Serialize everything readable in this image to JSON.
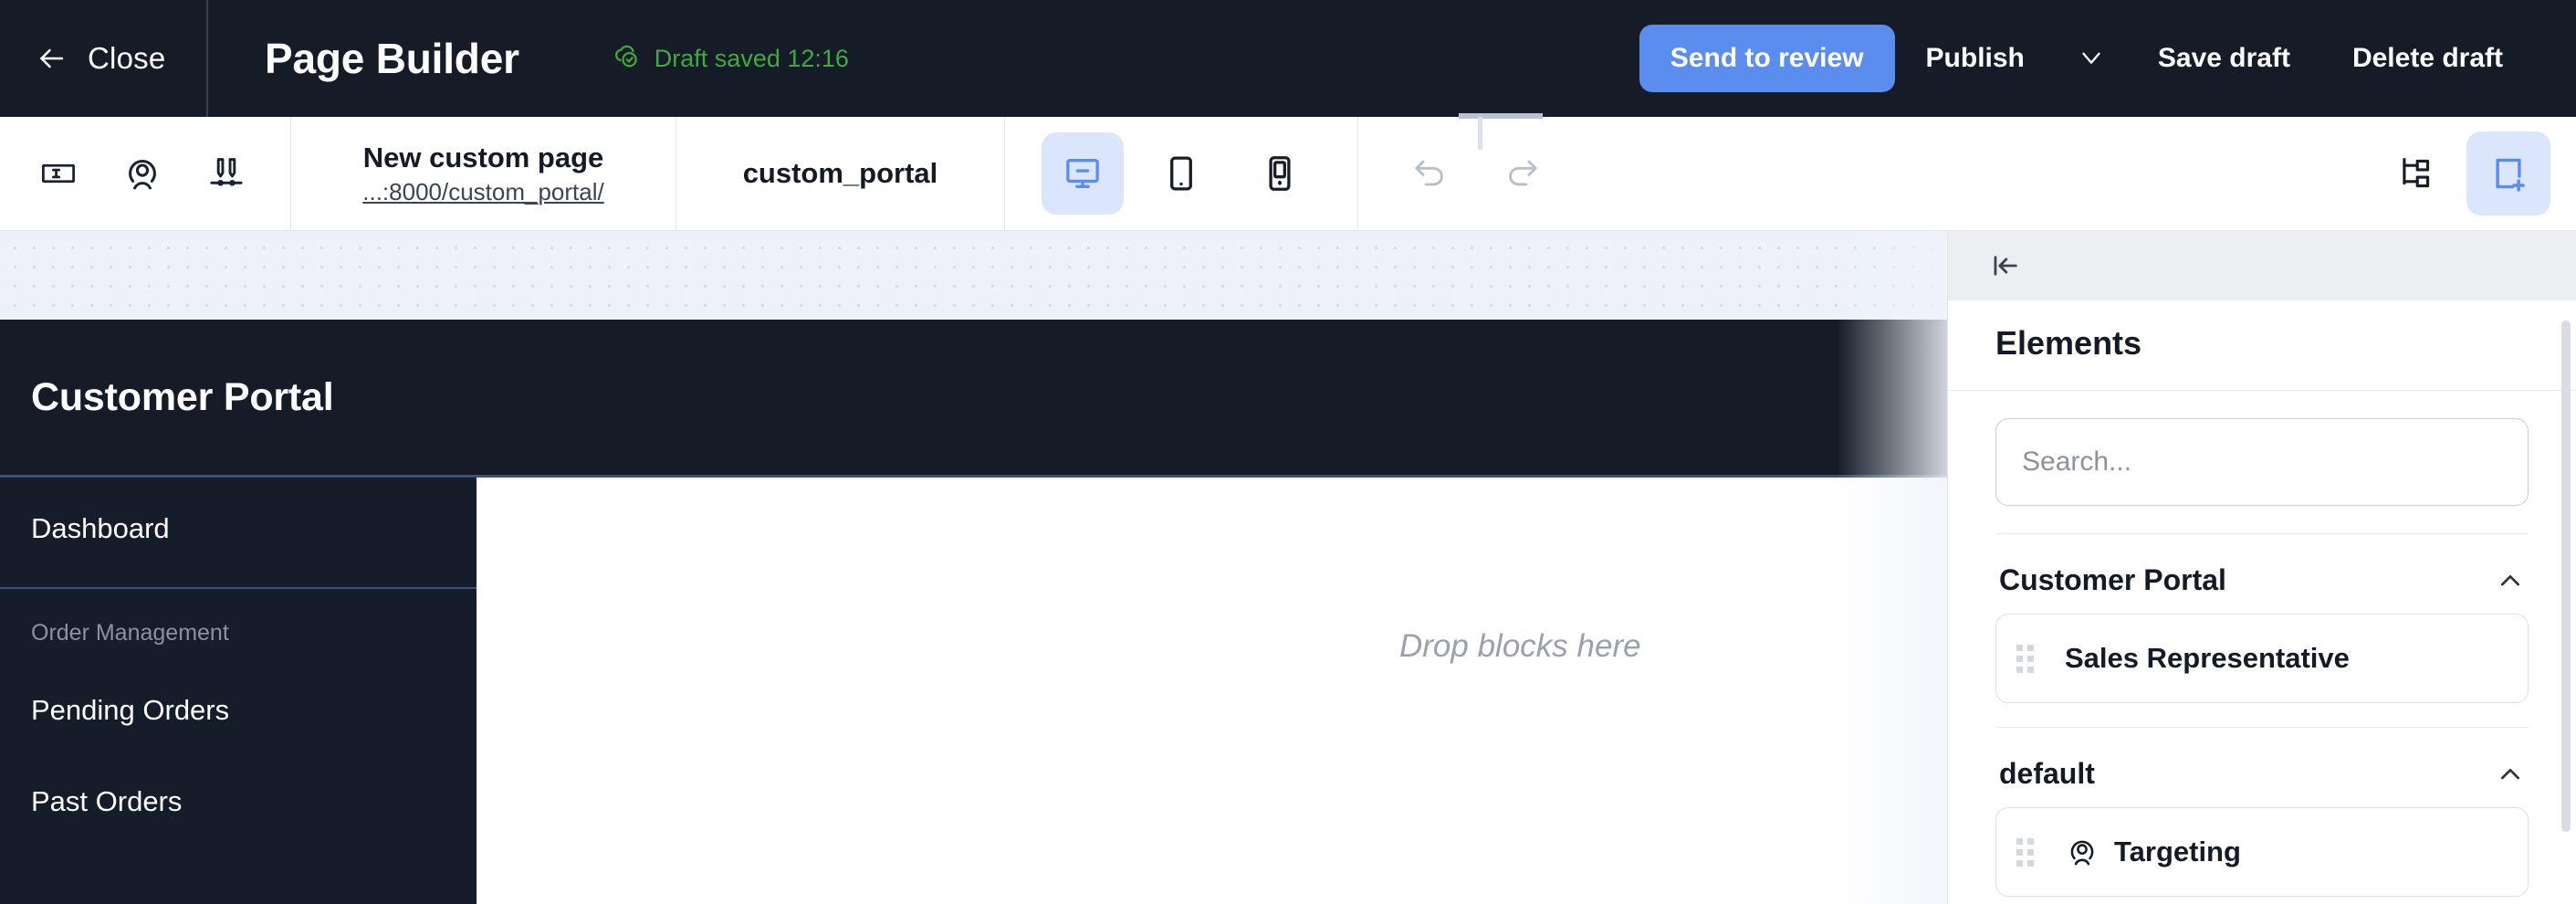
{
  "topbar": {
    "close_label": "Close",
    "app_title": "Page Builder",
    "draft_status": "Draft saved 12:16",
    "draft_status_color": "#3faa3f",
    "send_to_review_label": "Send to review",
    "publish_label": "Publish",
    "save_draft_label": "Save draft",
    "delete_draft_label": "Delete draft",
    "primary_color": "#5b8def",
    "background": "#151c28"
  },
  "toolbar": {
    "icons": [
      {
        "name": "text-field-icon"
      },
      {
        "name": "targeting-person-icon"
      },
      {
        "name": "ab-test-icon"
      }
    ],
    "page_title": "New custom page",
    "page_url": "...:8000/custom_portal/",
    "site_name": "custom_portal",
    "devices": [
      {
        "name": "desktop",
        "active": true
      },
      {
        "name": "tablet",
        "active": false
      },
      {
        "name": "mobile",
        "active": false
      }
    ],
    "history": [
      {
        "name": "undo"
      },
      {
        "name": "redo"
      }
    ],
    "right_tools": [
      {
        "name": "layers-tree",
        "active": false
      },
      {
        "name": "add-block",
        "active": true
      }
    ]
  },
  "canvas": {
    "portal_title": "Customer Portal",
    "drop_hint": "Drop blocks here",
    "nav": [
      {
        "type": "item",
        "label": "Dashboard"
      },
      {
        "type": "divider"
      },
      {
        "type": "section",
        "label": "Order Management"
      },
      {
        "type": "item",
        "label": "Pending Orders"
      },
      {
        "type": "item",
        "label": "Past Orders"
      }
    ],
    "header_background": "#151c28",
    "sidebar_background": "#161d2a",
    "accent_border": "#3b5080"
  },
  "panel": {
    "title": "Elements",
    "search_placeholder": "Search...",
    "search_value": "",
    "groups": [
      {
        "name": "Customer Portal",
        "expanded": true,
        "items": [
          {
            "label": "Sales Representative",
            "icon": ""
          }
        ]
      },
      {
        "name": "default",
        "expanded": true,
        "items": [
          {
            "label": "Targeting",
            "icon": "targeting-person-icon"
          }
        ]
      }
    ]
  }
}
